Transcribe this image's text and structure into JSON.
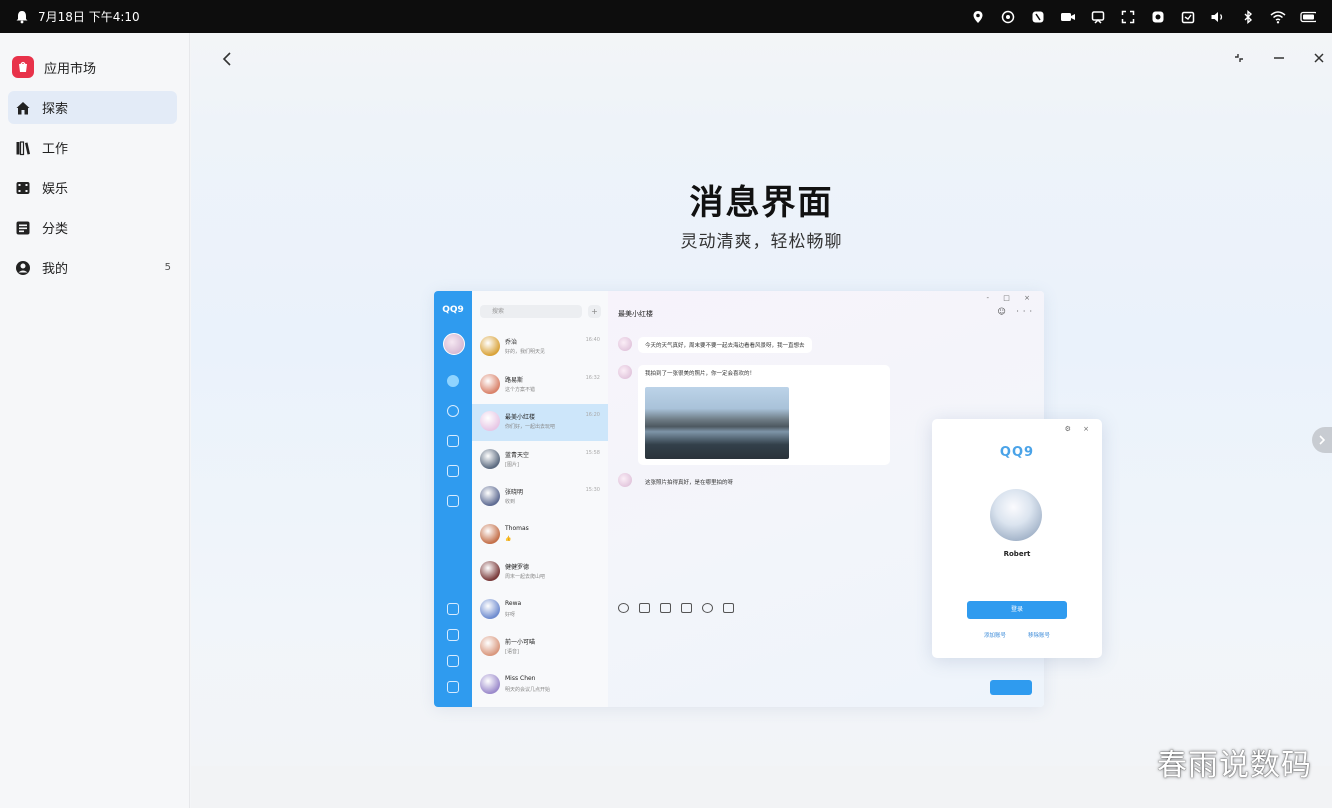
{
  "statusbar": {
    "datetime": "7月18日 下午4:10",
    "icons": [
      "bell-icon",
      "location-icon",
      "fan-icon",
      "nfc-icon",
      "camera-icon",
      "cast-icon",
      "screenshot-icon",
      "record-icon",
      "calendar-icon",
      "volume-icon",
      "bluetooth-icon",
      "wifi-icon",
      "battery-icon"
    ]
  },
  "sidebar": {
    "app_name": "应用市场",
    "items": [
      {
        "label": "探索",
        "icon": "home-icon",
        "active": true
      },
      {
        "label": "工作",
        "icon": "books-icon"
      },
      {
        "label": "娱乐",
        "icon": "film-icon"
      },
      {
        "label": "分类",
        "icon": "grid-list-icon"
      },
      {
        "label": "我的",
        "icon": "user-icon",
        "badge": "5"
      }
    ]
  },
  "hero": {
    "title": "消息界面",
    "subtitle": "灵动清爽，轻松畅聊"
  },
  "mock": {
    "rail_logo": "QQ9",
    "search_placeholder": "搜索",
    "plus": "+",
    "conversations": [
      {
        "name": "乔治",
        "preview": "好的，我们明天见",
        "time": "16:40",
        "color": "#d9a33a"
      },
      {
        "name": "路易斯",
        "preview": "这个方案不错",
        "time": "16:32",
        "color": "#d9826a"
      },
      {
        "name": "最美小红楼",
        "preview": "你们好，一起出去玩吧",
        "time": "16:20",
        "color": "#e7c7e5",
        "active": true
      },
      {
        "name": "蓝青天空",
        "preview": "[图片]",
        "time": "15:58",
        "color": "#5c6b80"
      },
      {
        "name": "张晓明",
        "preview": "收到",
        "time": "15:30",
        "color": "#5f6c93"
      },
      {
        "name": "Thomas",
        "preview": "👍",
        "time": "",
        "color": "#c4704a"
      },
      {
        "name": "健健罗德",
        "preview": "周末一起去爬山吧",
        "time": "",
        "color": "#7a3a3a"
      },
      {
        "name": "Rewa",
        "preview": "好呀",
        "time": "",
        "color": "#6f8ccf"
      },
      {
        "name": "前一小可喵",
        "preview": "[语音]",
        "time": "",
        "color": "#d9987e"
      },
      {
        "name": "Miss Chen",
        "preview": "明天的会议几点开始",
        "time": "",
        "color": "#9b8acb"
      }
    ],
    "chat_title": "最美小红楼",
    "chat_ctrls": "- □ ×",
    "chat_tools": "☺ ···",
    "messages": [
      "今天的天气真好，周末要不要一起去海边看看风景呀，我一直想去",
      "我拍到了一张很美的照片，你一定会喜欢的！",
      "这张照片拍得真好，是在哪里拍的呀"
    ],
    "login": {
      "ctrls": "⚙ ×",
      "logo": "QQ9",
      "name": "Robert",
      "button": "登录",
      "link_left": "添加账号",
      "link_right": "移除账号"
    }
  },
  "watermark": "春雨说数码"
}
